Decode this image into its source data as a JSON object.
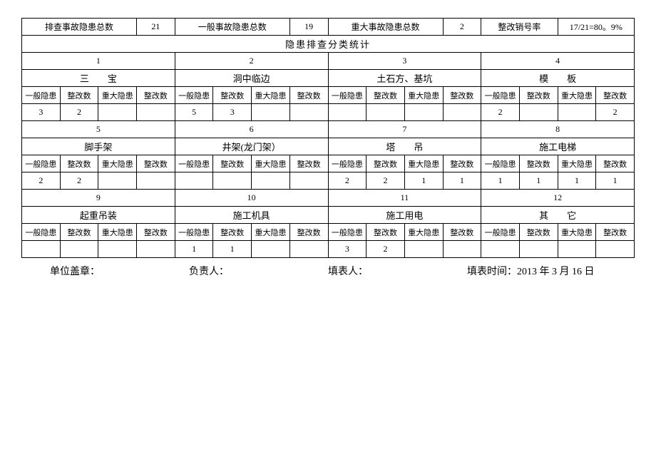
{
  "summary": {
    "investigated_label": "排查事故隐患总数",
    "investigated_value": "21",
    "general_label": "一般事故隐患总数",
    "general_value": "19",
    "major_label": "重大事故隐患总数",
    "major_value": "2",
    "rate_label": "整改销号率",
    "rate_value": "17/21=80。9%"
  },
  "stats_header": "隐患排查分类统计",
  "group_numbers": [
    "1",
    "2",
    "3",
    "4",
    "5",
    "6",
    "7",
    "8",
    "9",
    "10",
    "11",
    "12"
  ],
  "subheaders": {
    "general": "一般隐患",
    "rect": "整改数",
    "major": "重大隐患",
    "rect2": "整改数"
  },
  "categories_row1": [
    {
      "name_html": "三　　宝",
      "vals": [
        "3",
        "2",
        "",
        ""
      ]
    },
    {
      "name_html": "洞中临边",
      "vals": [
        "5",
        "3",
        "",
        ""
      ]
    },
    {
      "name_html": "土石方、基坑",
      "vals": [
        "",
        "",
        "",
        ""
      ]
    },
    {
      "name_html": "模　　板",
      "vals": [
        "2",
        "",
        "",
        "2"
      ]
    }
  ],
  "categories_row2": [
    {
      "name_html": "脚手架",
      "vals": [
        "2",
        "2",
        "",
        ""
      ]
    },
    {
      "name_html": "井架(龙门架）",
      "vals": [
        "",
        "",
        "",
        ""
      ]
    },
    {
      "name_html": "塔　　吊",
      "vals": [
        "2",
        "2",
        "1",
        "1"
      ]
    },
    {
      "name_html": "施工电梯",
      "vals": [
        "1",
        "1",
        "1",
        "1"
      ]
    }
  ],
  "categories_row3": [
    {
      "name_html": "起重吊装",
      "vals": [
        "",
        "",
        "",
        ""
      ]
    },
    {
      "name_html": "施工机具",
      "vals": [
        "1",
        "1",
        "",
        ""
      ]
    },
    {
      "name_html": "施工用电",
      "vals": [
        "3",
        "2",
        "",
        ""
      ]
    },
    {
      "name_html": "其　　它",
      "vals": [
        "",
        "",
        "",
        ""
      ]
    }
  ],
  "footer": {
    "stamp": "单位盖章：",
    "responsible": "负责人：",
    "filler": "填表人：",
    "time_label": "填表时间：",
    "time_value": "2013 年 3 月 16 日"
  }
}
